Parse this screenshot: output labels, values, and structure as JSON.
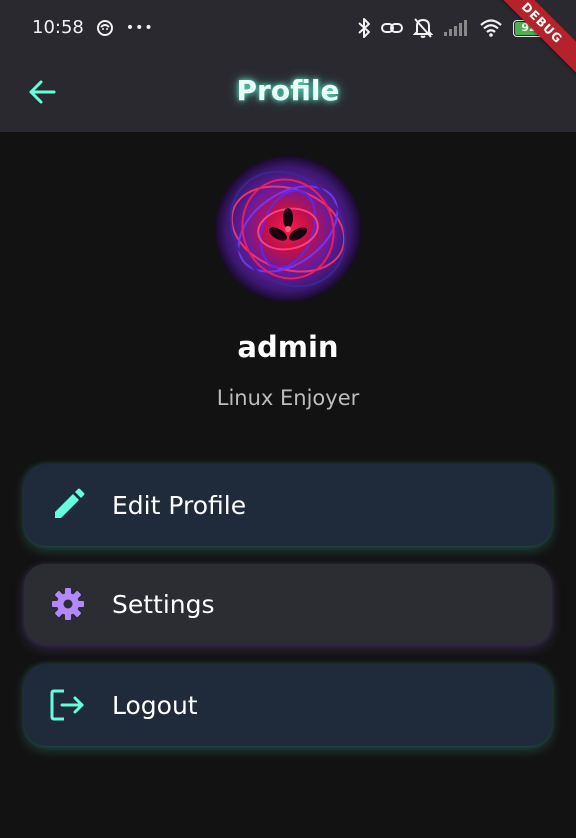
{
  "status_bar": {
    "time": "10:58",
    "more": "•••",
    "battery_level": "92"
  },
  "debug_banner": "DEBUG",
  "app_bar": {
    "title": "Profile"
  },
  "profile": {
    "username": "admin",
    "bio": "Linux Enjoyer"
  },
  "menu": [
    {
      "label": "Edit Profile",
      "icon": "pencil-icon",
      "color": "#64ffda"
    },
    {
      "label": "Settings",
      "icon": "gear-icon",
      "color": "#b388ff"
    },
    {
      "label": "Logout",
      "icon": "logout-icon",
      "color": "#64ffda"
    }
  ],
  "colors": {
    "accent": "#64ffda",
    "secondary_accent": "#b388ff",
    "background": "#121212",
    "app_bar": "#2a2930"
  }
}
